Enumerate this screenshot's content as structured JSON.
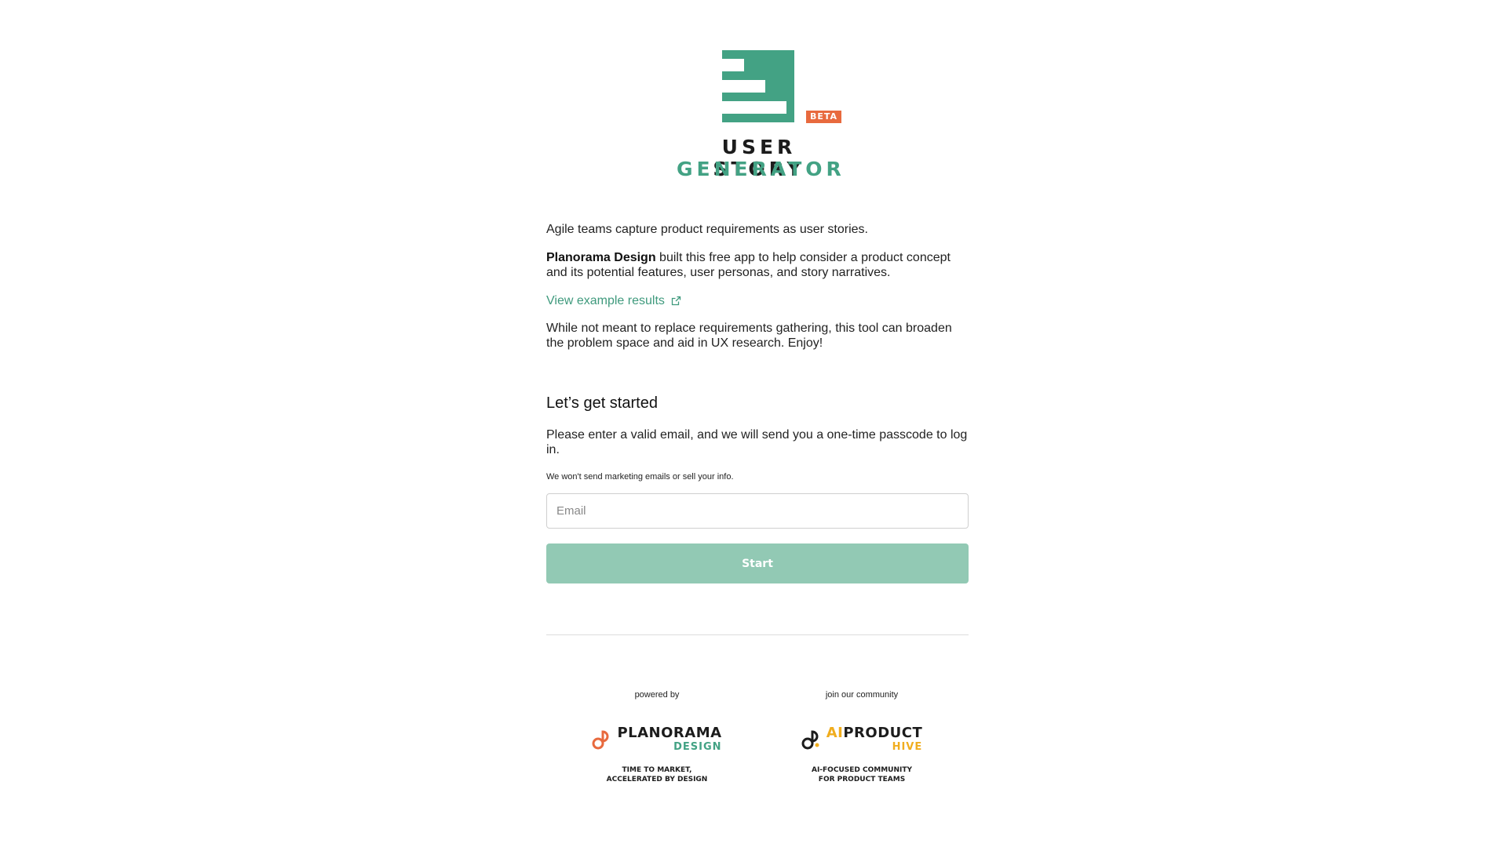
{
  "logo": {
    "badge": "BETA",
    "title_line1": "USER STORY",
    "title_line2": "GENERATOR",
    "icon": "document-bars-logo-icon",
    "brand_color": "#43a284",
    "badge_color": "#e86a3e"
  },
  "intro": {
    "line1": "Agile teams capture product requirements as user stories.",
    "line2_bold": "Planorama Design",
    "line2_rest": " built this free app to help consider a product concept and its potential features, user personas, and story narratives.",
    "example_link": "View example results",
    "example_link_icon": "external-link-icon",
    "line3": "While not meant to replace requirements gathering, this tool can broaden the problem space and aid in UX research. Enjoy!"
  },
  "signup": {
    "heading": "Let’s get started",
    "instructions": "Please enter a valid email, and we will send you a one-time passcode to log in.",
    "note": "We won't send marketing emails or sell your info.",
    "email_placeholder": "Email",
    "email_value": "",
    "start_label": "Start",
    "button_color": "#92c9b4"
  },
  "footer": {
    "left": {
      "caption": "powered by",
      "brand_main": "PLANORAMA",
      "brand_sub": "DESIGN",
      "logo_icon": "planorama-logo-icon",
      "tagline": "TIME TO MARKET,\nACCELERATED BY DESIGN"
    },
    "right": {
      "caption": "join our community",
      "brand_ai": "AI",
      "brand_main": "PRODUCT",
      "brand_sub": "HIVE",
      "logo_icon": "aiproduct-hive-logo-icon",
      "tagline": "AI-FOCUSED COMMUNITY\nFOR PRODUCT TEAMS"
    }
  }
}
